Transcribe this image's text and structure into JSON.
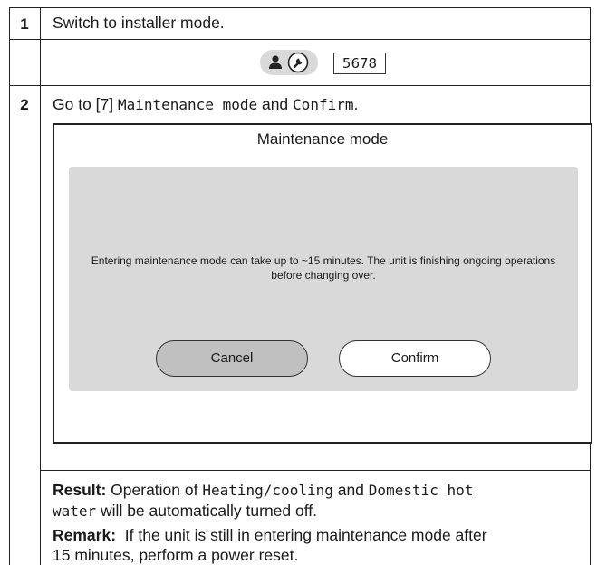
{
  "step1": {
    "number": "1",
    "text": "Switch to installer mode.",
    "pin": "5678",
    "icons": [
      "person-icon",
      "wrench-icon"
    ]
  },
  "step2": {
    "number": "2",
    "intro_prefix": "Go to [7] ",
    "intro_menu": "Maintenance mode",
    "intro_and": " and ",
    "intro_confirm": "Confirm",
    "intro_suffix": ".",
    "screen": {
      "title": "Maintenance mode",
      "message": "Entering maintenance mode can take up to ~15 minutes. The unit is finishing ongoing operations before changing over.",
      "cancel_label": "Cancel",
      "confirm_label": "Confirm"
    },
    "result_label": "Result:",
    "result_text1": " Operation of ",
    "result_code1": "Heating/cooling",
    "result_text2": " and ",
    "result_code2_line1": "Domestic hot",
    "result_code2_line2": "water",
    "result_text3": " will be automatically turned off.",
    "remark_label": "Remark:",
    "remark_line1": "  If the unit is still in entering maintenance mode after",
    "remark_line2": "15 minutes, perform a power reset."
  },
  "colors": {
    "dialog_bg": "#d9d9d9",
    "cancel_bg": "#c0c0c0",
    "border": "#222222"
  }
}
